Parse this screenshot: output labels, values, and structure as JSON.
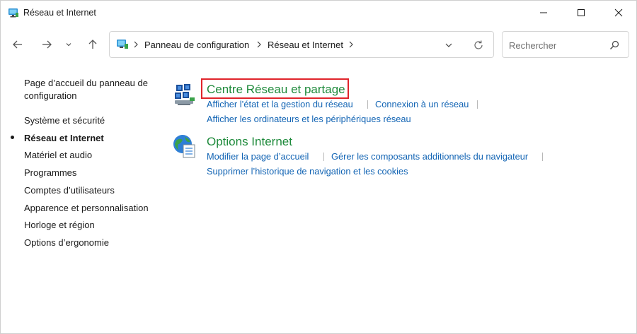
{
  "window": {
    "title": "Réseau et Internet",
    "controls": [
      "minimize-icon",
      "maximize-icon",
      "close-icon"
    ]
  },
  "address_bar": {
    "breadcrumbs": [
      "Panneau de configuration",
      "Réseau et Internet"
    ]
  },
  "search": {
    "placeholder": "Rechercher"
  },
  "sidebar": {
    "home": "Page d’accueil du panneau de configuration",
    "items": [
      {
        "label": "Système et sécurité",
        "active": false
      },
      {
        "label": "Réseau et Internet",
        "active": true
      },
      {
        "label": "Matériel et audio",
        "active": false
      },
      {
        "label": "Programmes",
        "active": false
      },
      {
        "label": "Comptes d’utilisateurs",
        "active": false
      },
      {
        "label": "Apparence et personnalisation",
        "active": false
      },
      {
        "label": "Horloge et région",
        "active": false
      },
      {
        "label": "Options d’ergonomie",
        "active": false
      }
    ]
  },
  "categories": [
    {
      "title": "Centre Réseau et partage",
      "icon": "network-center-icon",
      "highlighted": true,
      "links": [
        "Afficher l’état et la gestion du réseau",
        "Connexion à un réseau",
        "Afficher les ordinateurs et les périphériques réseau"
      ]
    },
    {
      "title": "Options Internet",
      "icon": "internet-options-icon",
      "highlighted": false,
      "links": [
        "Modifier la page d’accueil",
        "Gérer les composants additionnels du navigateur",
        "Supprimer l’historique de navigation et les cookies"
      ]
    }
  ],
  "colors": {
    "category_title": "#1e8a3b",
    "link": "#1264b4",
    "highlight_border": "#e0242b"
  }
}
